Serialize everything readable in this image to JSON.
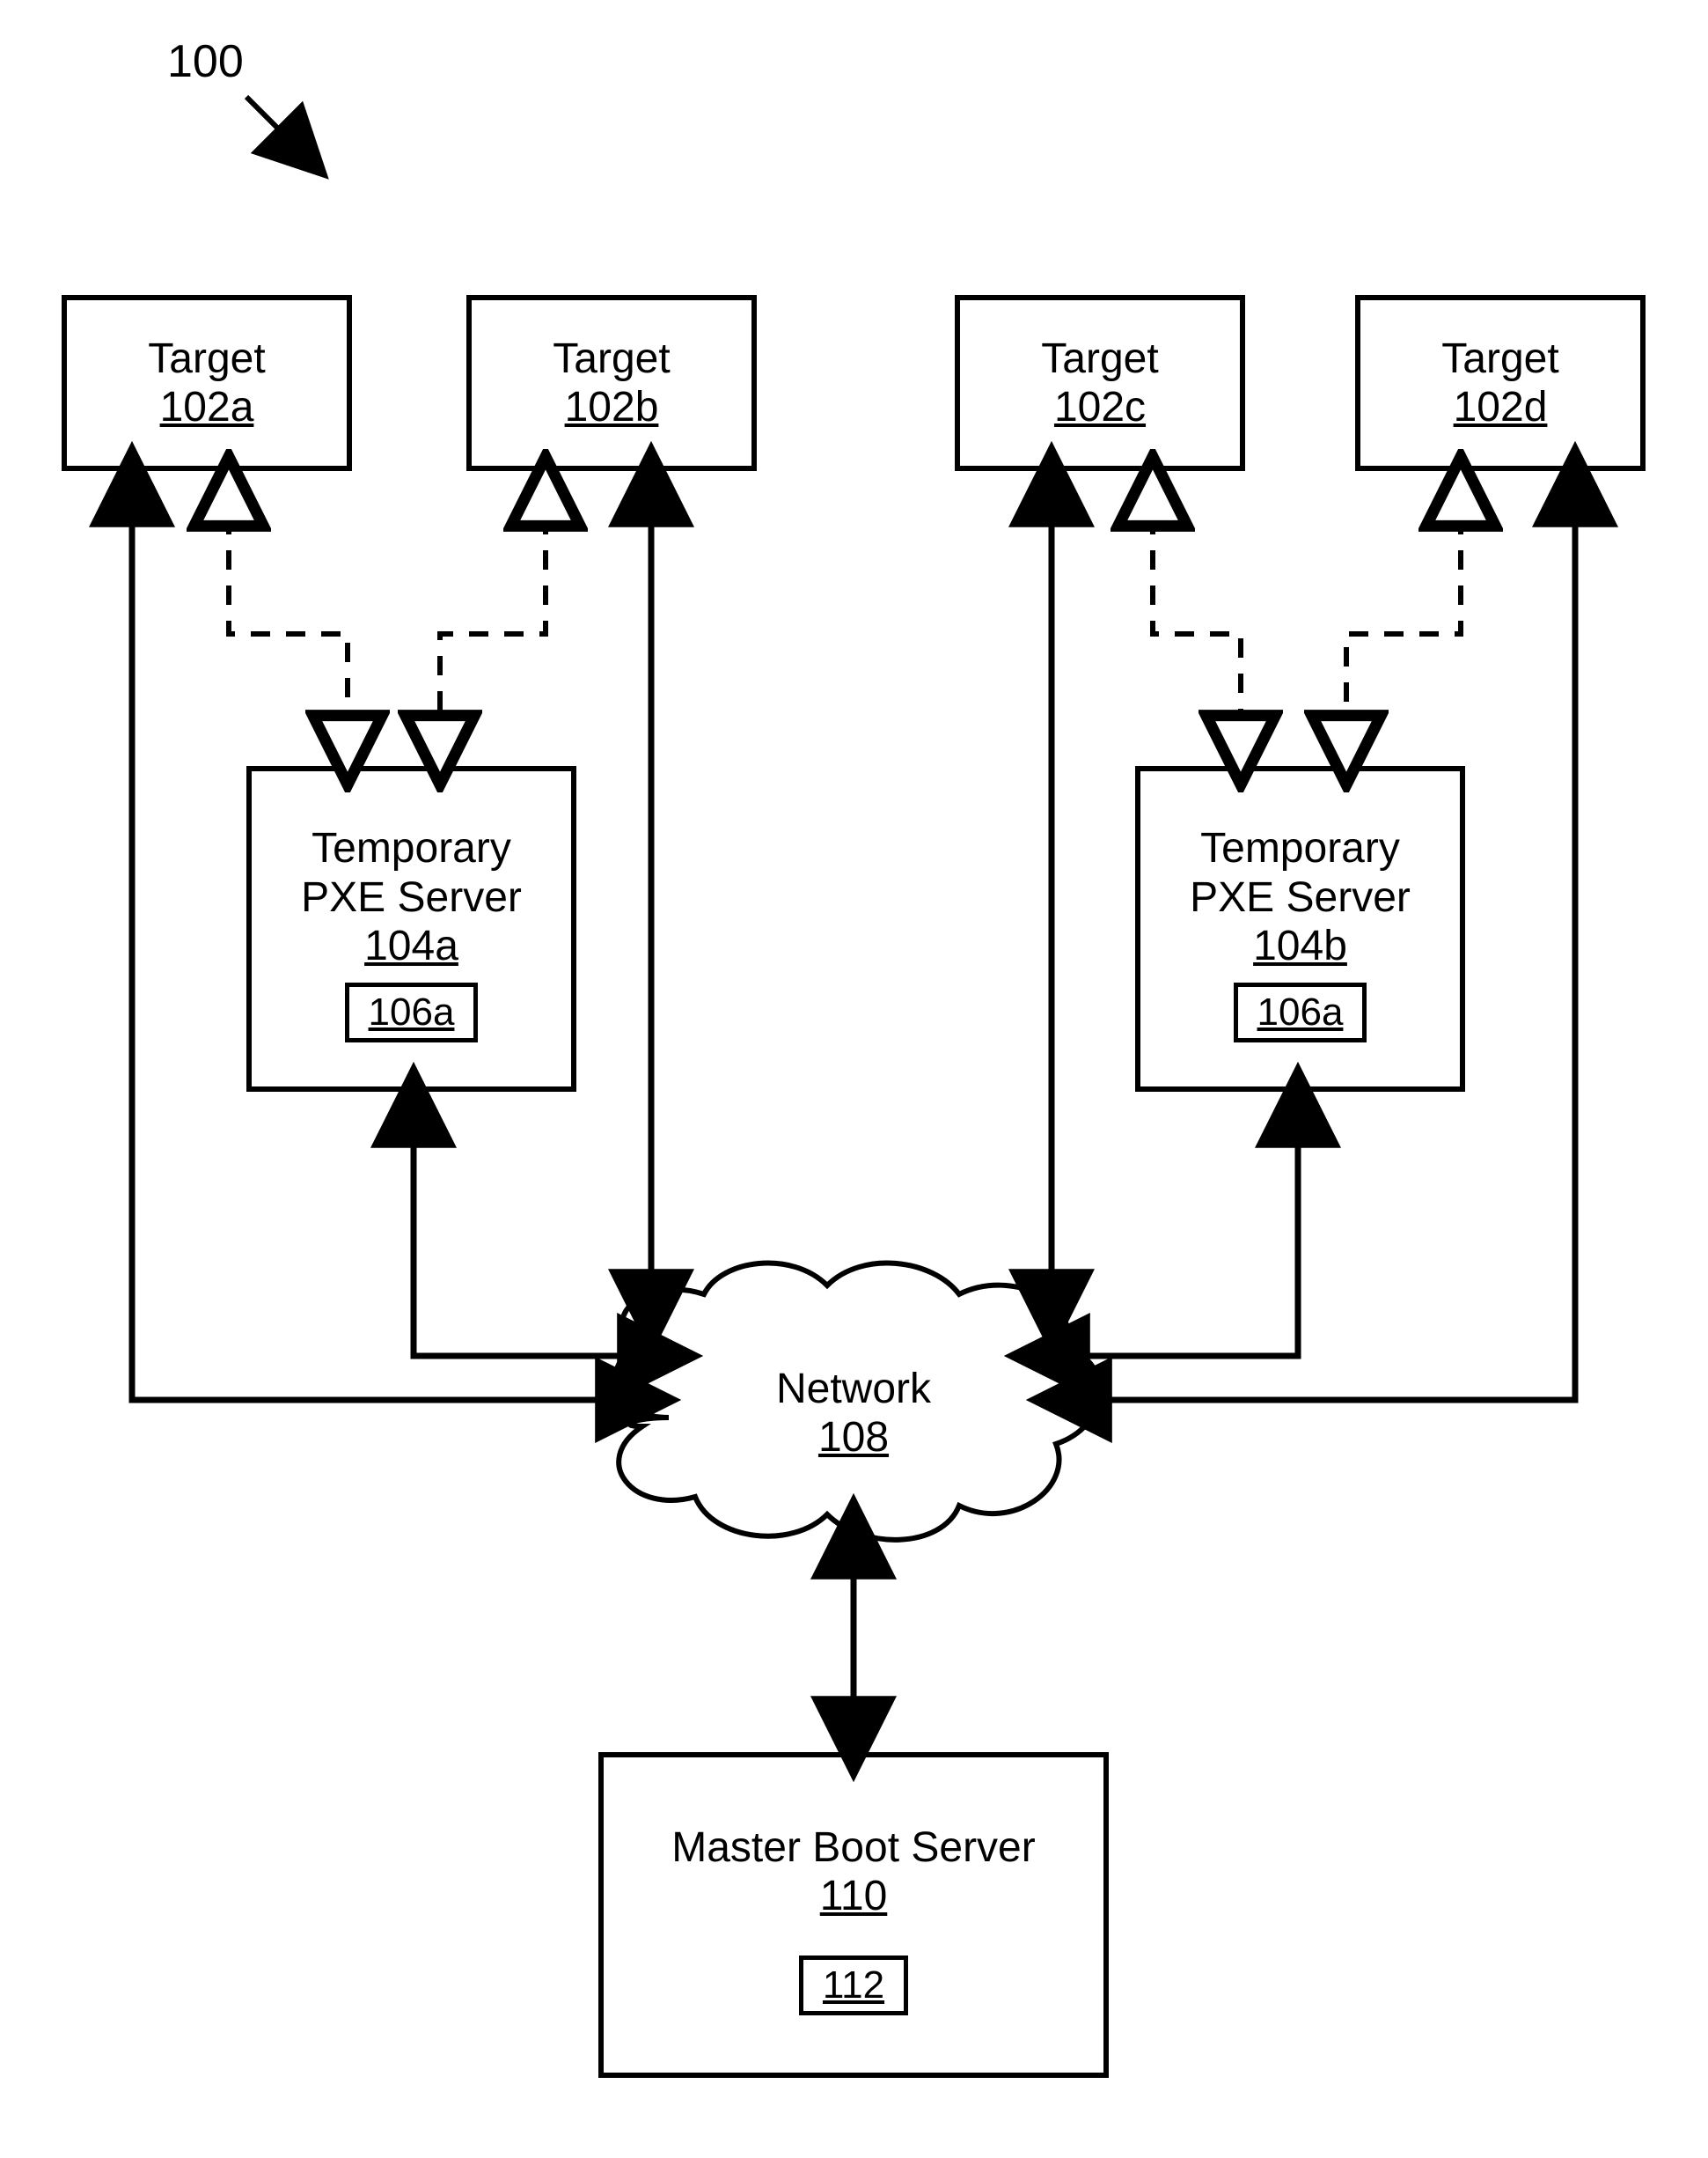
{
  "figure_ref": "100",
  "targets": {
    "a": {
      "label": "Target",
      "ref": "102a"
    },
    "b": {
      "label": "Target",
      "ref": "102b"
    },
    "c": {
      "label": "Target",
      "ref": "102c"
    },
    "d": {
      "label": "Target",
      "ref": "102d"
    }
  },
  "pxe": {
    "a": {
      "line1": "Temporary",
      "line2": "PXE Server",
      "ref": "104a",
      "inner_ref": "106a"
    },
    "b": {
      "line1": "Temporary",
      "line2": "PXE Server",
      "ref": "104b",
      "inner_ref": "106a"
    }
  },
  "network": {
    "label": "Network",
    "ref": "108"
  },
  "master": {
    "label": "Master Boot Server",
    "ref": "110",
    "inner_ref": "112"
  }
}
